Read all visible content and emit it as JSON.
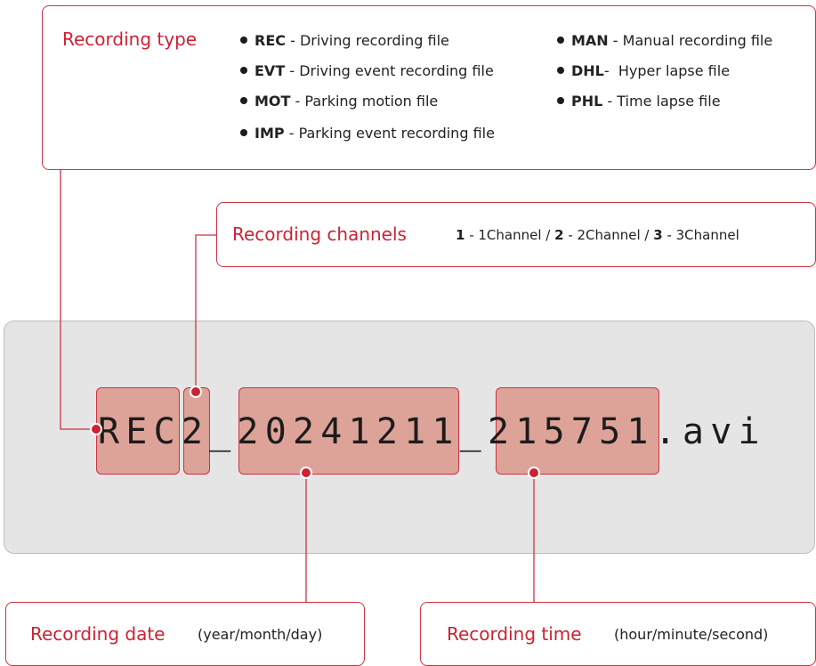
{
  "recording_type": {
    "title": "Recording type",
    "items": [
      {
        "code": "REC",
        "sep": " - ",
        "text": "Driving recording file"
      },
      {
        "code": "EVT",
        "sep": " - ",
        "text": "Driving event recording file"
      },
      {
        "code": "MOT",
        "sep": " - ",
        "text": "Parking motion file"
      },
      {
        "code": "IMP",
        "sep": " - ",
        "text": "Parking event recording file"
      },
      {
        "code": "MAN",
        "sep": " - ",
        "text": "Manual recording file"
      },
      {
        "code": "DHL",
        "sep": "-  ",
        "text": "Hyper lapse file"
      },
      {
        "code": "PHL",
        "sep": " - ",
        "text": "Time lapse file"
      }
    ]
  },
  "recording_channels": {
    "title": "Recording channels",
    "options": [
      {
        "num": "1",
        "label": "1Channel"
      },
      {
        "num": "2",
        "label": "2Channel"
      },
      {
        "num": "3",
        "label": "3Channel"
      }
    ],
    "dash": " - ",
    "separator": " / "
  },
  "filename": "REC2_20241211_215751.avi",
  "recording_date": {
    "title": "Recording date",
    "hint": "(year/month/day)"
  },
  "recording_time": {
    "title": "Recording time",
    "hint": "(hour/minute/second)"
  },
  "colors": {
    "accent": "#cc3344",
    "highlight": "#dea398",
    "panel": "#e5e5e5"
  }
}
